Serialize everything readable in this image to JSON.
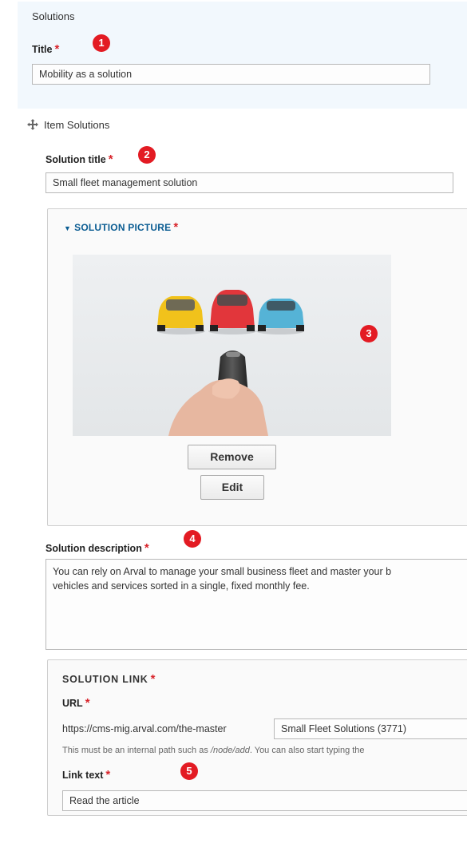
{
  "solutions_section": {
    "heading": "Solutions",
    "title_label": "Title",
    "title_value": "Mobility as a solution",
    "required_mark": "*"
  },
  "item": {
    "label": "Item Solutions",
    "drag_icon": "move-icon",
    "solution_title_label": "Solution title",
    "solution_title_value": "Small fleet management solution"
  },
  "picture": {
    "legend": "SOLUTION PICTURE",
    "toggle_icon": "triangle-down-icon",
    "remove_label": "Remove",
    "edit_label": "Edit"
  },
  "description": {
    "label": "Solution description",
    "value_line1": "You can rely on Arval to manage your small business fleet and master your b",
    "value_line2": "vehicles and services sorted in a single, fixed monthly fee."
  },
  "link": {
    "legend": "SOLUTION LINK",
    "url_label": "URL",
    "url_prefix": "https://cms-mig.arval.com/the-master",
    "url_value": "Small Fleet Solutions (3771)",
    "help_prefix": "This must be an internal path such as ",
    "help_path": "/node/add",
    "help_suffix": ". You can also start typing the",
    "link_text_label": "Link text",
    "link_text_value": "Read the article"
  },
  "markers": [
    "1",
    "2",
    "3",
    "4",
    "5"
  ],
  "colors": {
    "panel_bg": "#f2f8fd",
    "required": "#d8232a",
    "marker": "#e31b23",
    "legend_link": "#0a5c92"
  }
}
